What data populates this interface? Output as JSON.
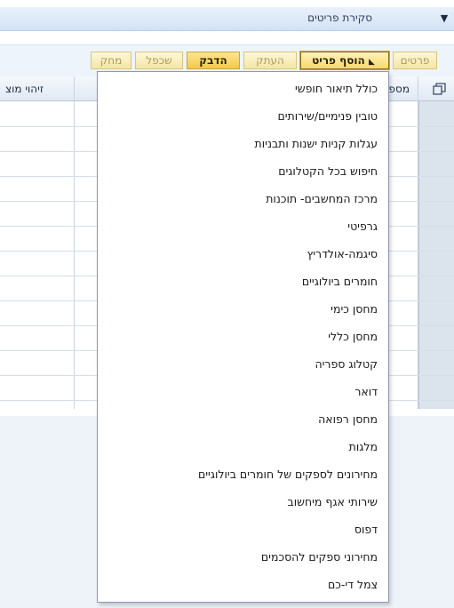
{
  "header": {
    "title": "סקירת פריטים",
    "toggle_glyph": "▼"
  },
  "toolbar": {
    "buttons": [
      {
        "label": "פרטים",
        "state": "normal"
      },
      {
        "label": "הוסף פריט",
        "state": "pressed"
      },
      {
        "label": "העתק",
        "state": "normal"
      },
      {
        "label": "הדבק",
        "state": "active"
      },
      {
        "label": "שכפל",
        "state": "normal"
      },
      {
        "label": "מחק",
        "state": "normal"
      }
    ],
    "add_item_arrow_glyph": "◣"
  },
  "table": {
    "columns": [
      "מספר",
      "זיהוי מוצ"
    ],
    "row_count": 12
  },
  "menu": {
    "items": [
      "כולל תיאור חופשי",
      "טובין פנימיים/שירותים",
      "עגלות קניות ישנות ותבניות",
      "חיפוש בכל הקטלוגים",
      "מרכז המחשבים- תוכנות",
      "גרפיטי",
      "סיגמה-אולדריץ",
      "חומרים ביולוגיים",
      "מחסן כימי",
      "מחסן כללי",
      "קטלוג ספריה",
      "דואר",
      "מחסן רפואה",
      "מלגות",
      "מחירונים לספקים של חומרים ביולוגיים",
      "שירותי אגף מיחשוב",
      "דפוס",
      "מחירוני ספקים להסכמים",
      "צמל די-כם"
    ]
  },
  "colors": {
    "header_bg": "#d3e3f5",
    "button_bg": "#f4e6a6",
    "button_active_bg": "#f3c94a",
    "selector_col_bg": "#dbe3ec",
    "bottom_bg": "#eef3f9"
  }
}
